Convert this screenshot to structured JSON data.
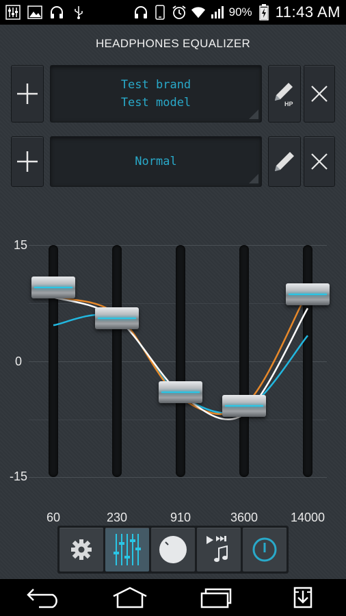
{
  "status_bar": {
    "battery_percent": "90%",
    "time": "11:43 AM",
    "left_icons": [
      "equalizer-notification-icon",
      "image-icon",
      "headphones-icon",
      "usb-icon"
    ],
    "right_icons": [
      "headphones-icon",
      "phone-icon",
      "alarm-icon",
      "wifi-icon",
      "signal-icon",
      "battery-charging-icon"
    ]
  },
  "app": {
    "title": "HEADPHONES EQUALIZER",
    "headphone_profile": {
      "brand": "Test brand",
      "model": "Test model",
      "add_icon": "plus-icon",
      "edit_icon": "pencil-hp-icon",
      "edit_badge": "HP",
      "delete_icon": "close-icon"
    },
    "preset": {
      "name": "Normal",
      "add_icon": "plus-icon",
      "edit_icon": "pencil-icon",
      "delete_icon": "close-icon"
    },
    "equalizer": {
      "y_labels": [
        "15",
        "0",
        "-15"
      ],
      "y_range_db": [
        -15,
        15
      ],
      "bands": [
        {
          "freq": "60",
          "gain_db": 9.5
        },
        {
          "freq": "230",
          "gain_db": 5.5
        },
        {
          "freq": "910",
          "gain_db": -4.0
        },
        {
          "freq": "3600",
          "gain_db": -5.8
        },
        {
          "freq": "14000",
          "gain_db": 8.6
        }
      ],
      "curve_colors": {
        "white": "#ffffff",
        "orange": "#e8892a",
        "cyan": "#22b8e0"
      },
      "accent": "#29c6e6"
    },
    "toolbar": [
      {
        "name": "settings",
        "icon": "gear-icon",
        "active": false
      },
      {
        "name": "equalizer",
        "icon": "sliders-icon",
        "active": true
      },
      {
        "name": "volume-knob",
        "icon": "knob-icon",
        "active": false
      },
      {
        "name": "media-controls",
        "icon": "play-music-icon",
        "active": false
      },
      {
        "name": "power",
        "icon": "power-icon",
        "active": false
      }
    ]
  },
  "nav_bar": {
    "buttons": [
      "back-icon",
      "home-icon",
      "recent-apps-icon",
      "download-icon"
    ]
  }
}
